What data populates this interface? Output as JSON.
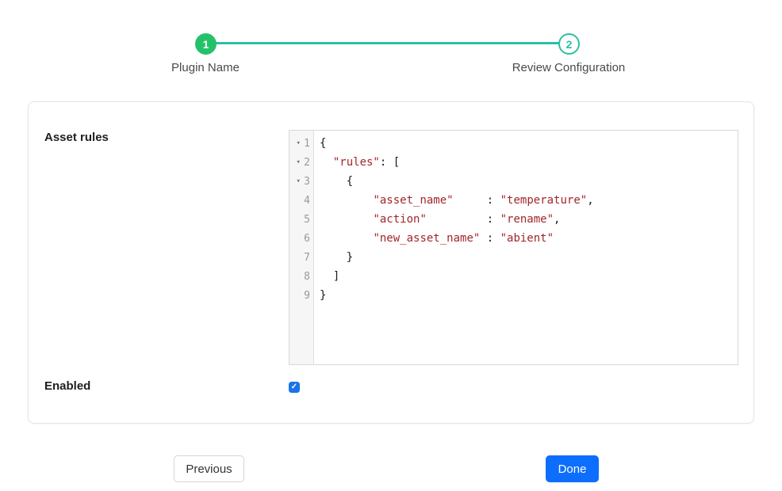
{
  "stepper": {
    "steps": [
      {
        "number": "1",
        "label": "Plugin Name",
        "state": "complete"
      },
      {
        "number": "2",
        "label": "Review Configuration",
        "state": "active"
      }
    ]
  },
  "form": {
    "asset_rules_label": "Asset rules",
    "enabled_label": "Enabled",
    "enabled_checked": true,
    "checkmark_glyph": "✓"
  },
  "editor": {
    "fold_arrow_glyph": "▾",
    "lines": [
      {
        "num": "1",
        "fold": true,
        "segments": [
          {
            "type": "plain",
            "text": "{"
          }
        ]
      },
      {
        "num": "2",
        "fold": true,
        "segments": [
          {
            "type": "plain",
            "text": "  "
          },
          {
            "type": "str",
            "text": "\"rules\""
          },
          {
            "type": "plain",
            "text": ": ["
          }
        ]
      },
      {
        "num": "3",
        "fold": true,
        "segments": [
          {
            "type": "plain",
            "text": "    {"
          }
        ]
      },
      {
        "num": "4",
        "fold": false,
        "segments": [
          {
            "type": "plain",
            "text": "        "
          },
          {
            "type": "str",
            "text": "\"asset_name\""
          },
          {
            "type": "plain",
            "text": "     : "
          },
          {
            "type": "str",
            "text": "\"temperature\""
          },
          {
            "type": "plain",
            "text": ","
          }
        ]
      },
      {
        "num": "5",
        "fold": false,
        "segments": [
          {
            "type": "plain",
            "text": "        "
          },
          {
            "type": "str",
            "text": "\"action\""
          },
          {
            "type": "plain",
            "text": "         : "
          },
          {
            "type": "str",
            "text": "\"rename\""
          },
          {
            "type": "plain",
            "text": ","
          }
        ]
      },
      {
        "num": "6",
        "fold": false,
        "segments": [
          {
            "type": "plain",
            "text": "        "
          },
          {
            "type": "str",
            "text": "\"new_asset_name\""
          },
          {
            "type": "plain",
            "text": " : "
          },
          {
            "type": "str",
            "text": "\"abient\""
          }
        ]
      },
      {
        "num": "7",
        "fold": false,
        "segments": [
          {
            "type": "plain",
            "text": "    }"
          }
        ]
      },
      {
        "num": "8",
        "fold": false,
        "segments": [
          {
            "type": "plain",
            "text": "  ]"
          }
        ]
      },
      {
        "num": "9",
        "fold": false,
        "segments": [
          {
            "type": "plain",
            "text": "}"
          }
        ]
      }
    ]
  },
  "buttons": {
    "previous": "Previous",
    "done": "Done"
  },
  "colors": {
    "step_complete_green": "#24c16b",
    "step_active_teal": "#2cbfa4",
    "string_red": "#a2262b",
    "checkbox_blue": "#1a73e8",
    "done_button_blue": "#0d6efd"
  }
}
